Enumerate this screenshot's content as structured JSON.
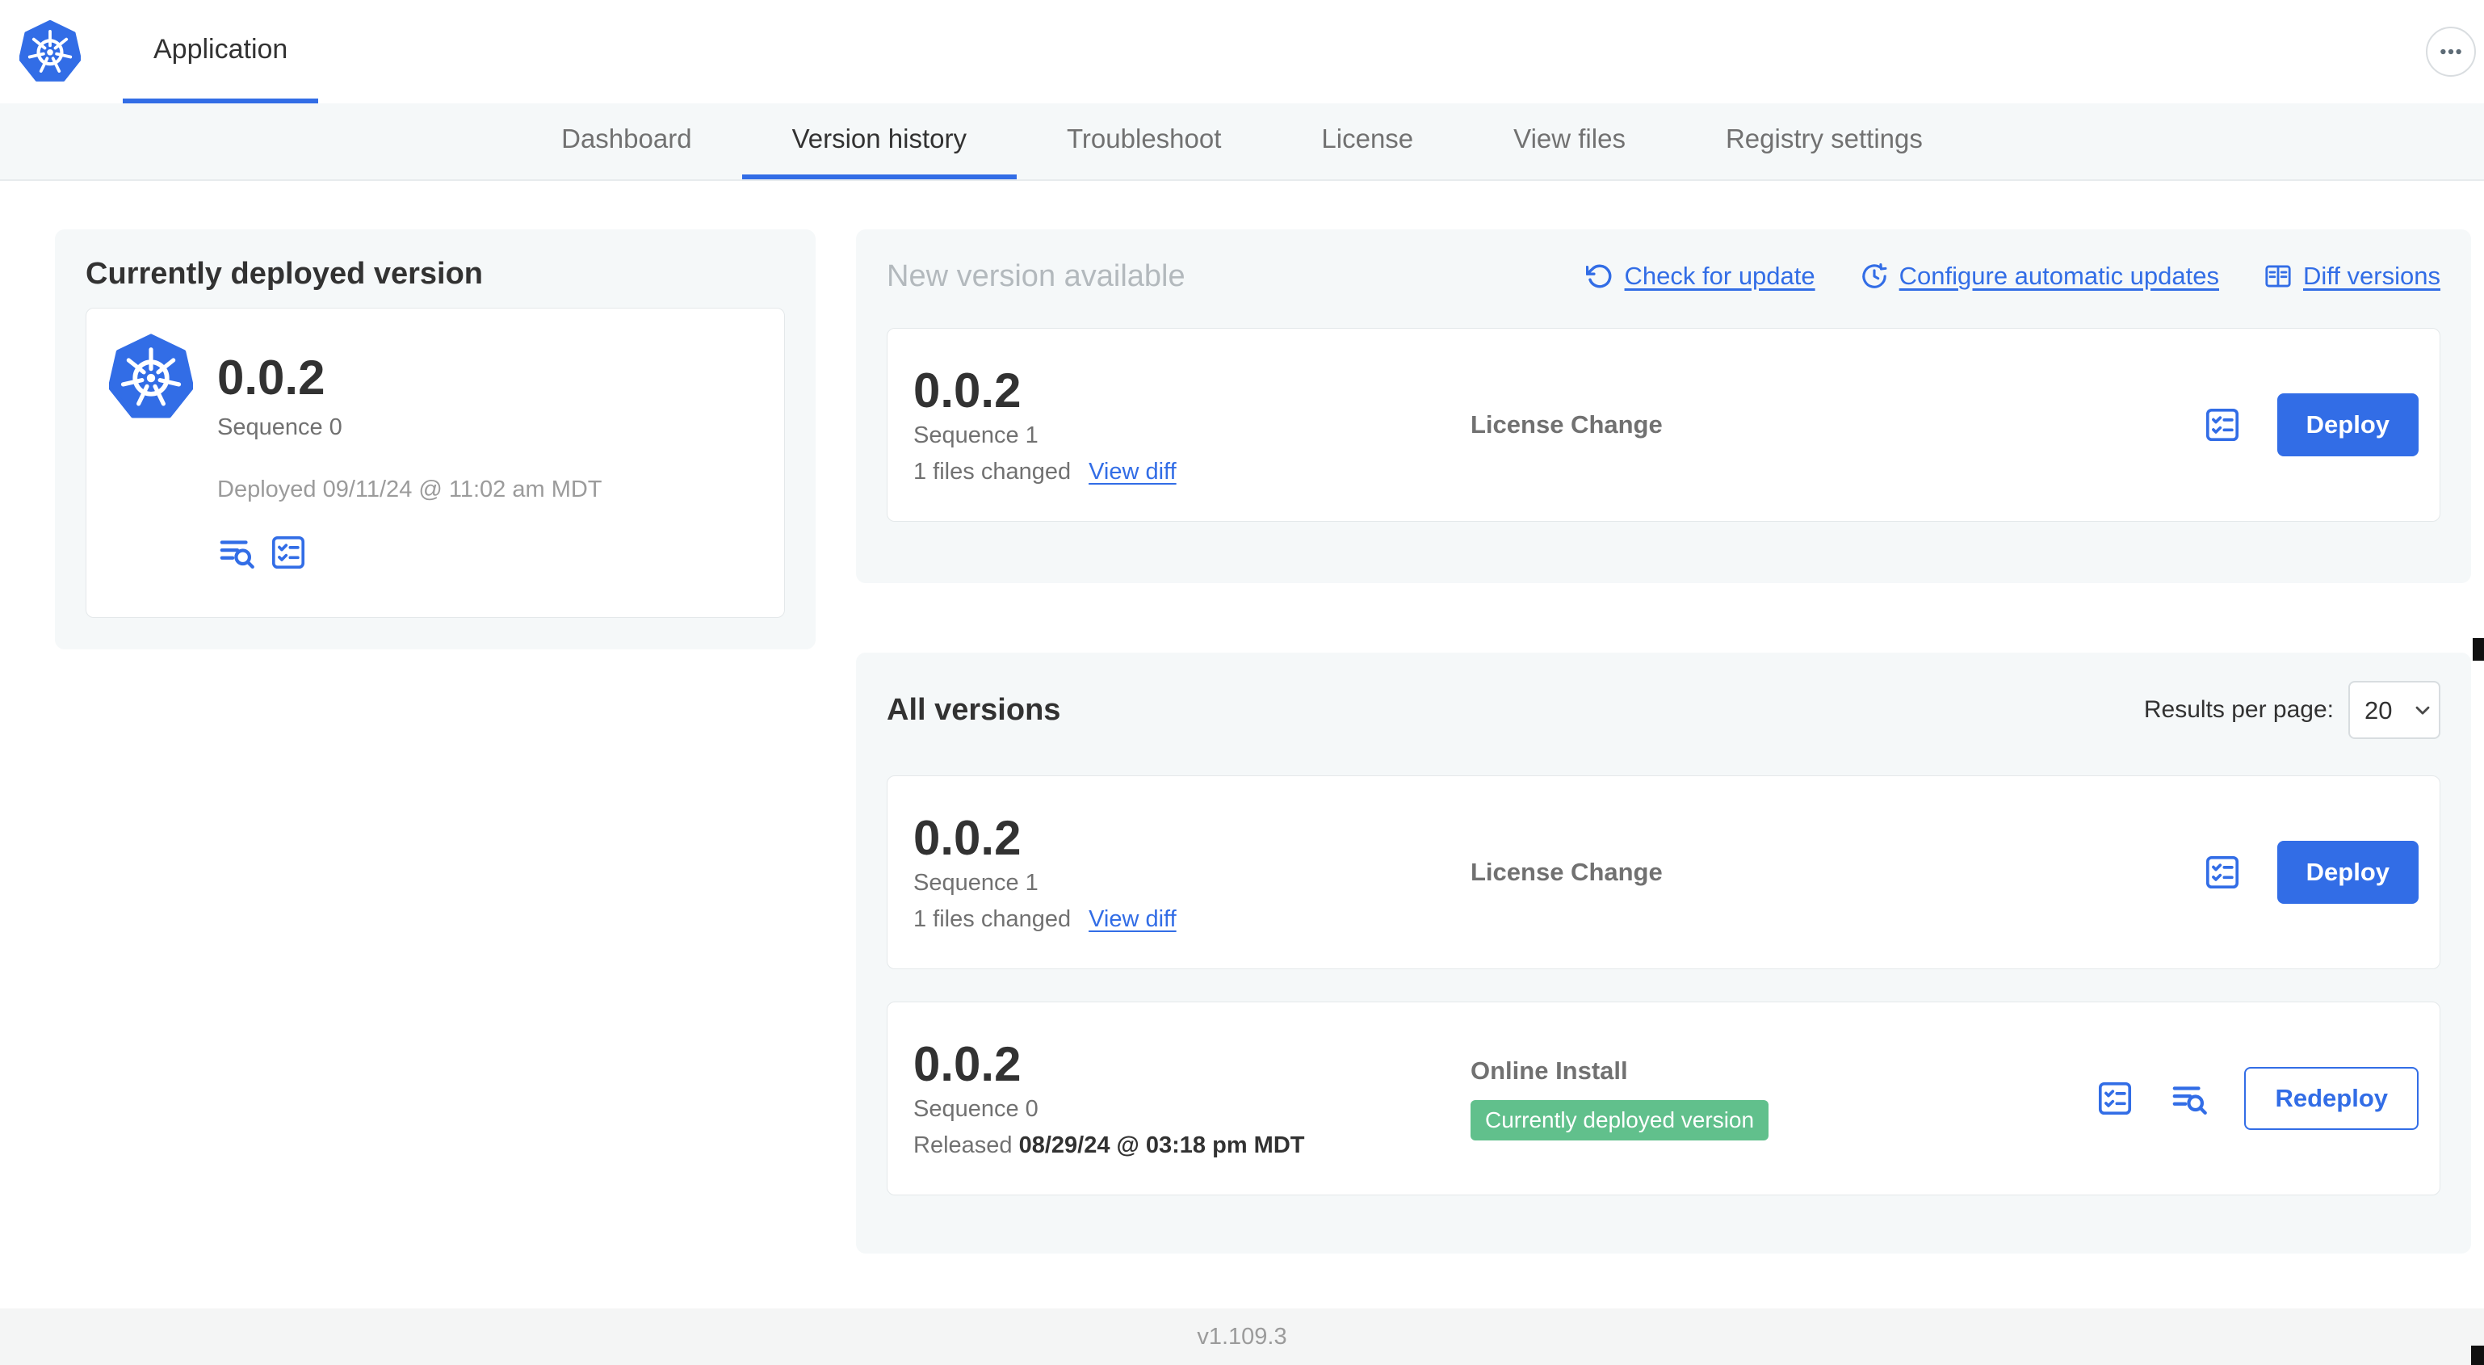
{
  "colors": {
    "primary": "#326de6",
    "success": "#61c08c",
    "card-bg": "#f5f8f9",
    "border": "#e4e8ea",
    "text-dark": "#323232",
    "text-gray": "#717171",
    "text-muted": "#9b9b9b",
    "title-muted": "#b3b9bd",
    "footer-bg": "#f4f5f5"
  },
  "icons": {
    "header_logo": "kubernetes-logo-icon",
    "more_menu": "ellipsis-icon",
    "check_for_update": "refresh-icon",
    "configure_automatic_updates": "clock-update-icon",
    "diff_versions": "diff-columns-icon",
    "release_notes": "lines-magnifier-icon",
    "config_values": "checklist-icon",
    "results_select": "chevron-down-icon"
  },
  "header": {
    "app_tab": "Application"
  },
  "nav": {
    "tabs": [
      {
        "label": "Dashboard",
        "active": false
      },
      {
        "label": "Version history",
        "active": true
      },
      {
        "label": "Troubleshoot",
        "active": false
      },
      {
        "label": "License",
        "active": false
      },
      {
        "label": "View files",
        "active": false
      },
      {
        "label": "Registry settings",
        "active": false
      }
    ]
  },
  "current": {
    "title": "Currently deployed version",
    "version": "0.0.2",
    "sequence": "Sequence 0",
    "deployed": "Deployed 09/11/24 @ 11:02 am MDT"
  },
  "new_version": {
    "title": "New version available",
    "actions": {
      "check_for_update": "Check for update",
      "configure_automatic_updates": "Configure automatic updates",
      "diff_versions": "Diff versions"
    },
    "row": {
      "version": "0.0.2",
      "sequence": "Sequence 1",
      "files_changed": "1 files changed",
      "view_diff": "View diff",
      "source": "License Change",
      "action_label": "Deploy"
    }
  },
  "all_versions": {
    "title": "All versions",
    "results_per_page_label": "Results per page:",
    "results_per_page_value": "20",
    "rows": [
      {
        "version": "0.0.2",
        "sequence": "Sequence 1",
        "files_changed": "1 files changed",
        "view_diff": "View diff",
        "source": "License Change",
        "action_label": "Deploy"
      },
      {
        "version": "0.0.2",
        "sequence": "Sequence 0",
        "released_prefix": "Released",
        "released_date": "08/29/24 @ 03:18 pm MDT",
        "source": "Online Install",
        "badge": "Currently deployed version",
        "action_label": "Redeploy"
      }
    ]
  },
  "footer": {
    "app_version": "v1.109.3"
  }
}
